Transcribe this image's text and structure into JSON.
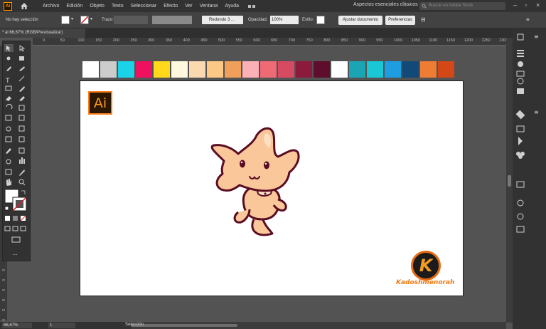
{
  "app": {
    "logo": "Ai"
  },
  "menu": {
    "items": [
      "Archivo",
      "Edición",
      "Objeto",
      "Texto",
      "Seleccionar",
      "Efecto",
      "Ver",
      "Ventana",
      "Ayuda"
    ]
  },
  "workspace": {
    "name": "Aspectos esenciales clásicos"
  },
  "search": {
    "placeholder": "Buscar en Adobe Stock"
  },
  "control": {
    "selection": "No hay selección",
    "stroke_label": "Trazo:",
    "brush": "Redondo 3 ...",
    "opacity_label": "Opacidad:",
    "opacity_value": "100%",
    "style_label": "Estilo:",
    "doc_setup": "Ajustar documento",
    "prefs": "Preferencias"
  },
  "tab": {
    "title": "* al 66,67% (RGB/Previsualizar)"
  },
  "ruler_h": [
    "0",
    "50",
    "100",
    "150",
    "200",
    "250",
    "300",
    "350",
    "400",
    "450",
    "500",
    "550",
    "600",
    "650",
    "700",
    "750",
    "800",
    "850",
    "900",
    "950",
    "1000",
    "1050",
    "1100",
    "1150",
    "1200",
    "1250",
    "1300"
  ],
  "ruler_v": [
    "5",
    "0",
    "0",
    "0",
    "8",
    "5",
    "0"
  ],
  "status": {
    "zoom": "66,67%",
    "page": "1",
    "tool": "Selección"
  },
  "palette": [
    "#ffffff",
    "#cccccc",
    "#1ad3e8",
    "#ef1060",
    "#ffd91a",
    "#fff8de",
    "#fbd9b0",
    "#fbc886",
    "#f1a05c",
    "#fbb0b5",
    "#ee6a74",
    "#d74b62",
    "#8c1a3d",
    "#5e0d2c",
    "#ffffff",
    "#1aa5b5",
    "#1ac8d5",
    "#1e9de1",
    "#114a78",
    "#ee7c33",
    "#d44818"
  ],
  "artboard": {
    "ai_badge": "Ai",
    "logo_letter": "K",
    "brand": "Kadoshmenorah"
  },
  "colors": {
    "cat_fill": "#fac79a",
    "cat_outline": "#5a0d22",
    "cat_light": "#fde6cd"
  }
}
